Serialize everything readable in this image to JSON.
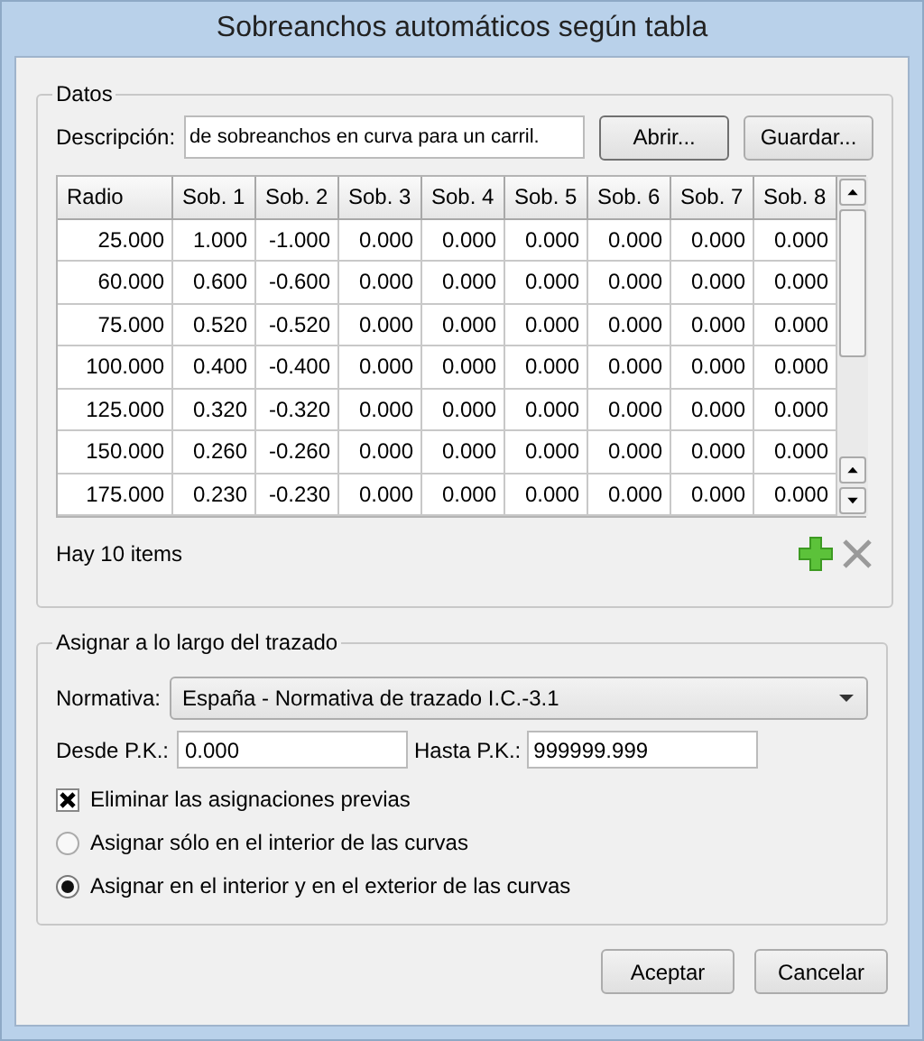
{
  "window": {
    "title": "Sobreanchos automáticos según tabla"
  },
  "datos": {
    "legend": "Datos",
    "description_label": "Descripción:",
    "description_value": "de sobreanchos en curva para un carril.",
    "buttons": [
      "Abrir...",
      "Guardar..."
    ],
    "table": {
      "columns": [
        "Radio",
        "Sob. 1",
        "Sob. 2",
        "Sob. 3",
        "Sob. 4",
        "Sob. 5",
        "Sob. 6",
        "Sob. 7",
        "Sob. 8"
      ],
      "rows": [
        [
          "25.000",
          "1.000",
          "-1.000",
          "0.000",
          "0.000",
          "0.000",
          "0.000",
          "0.000",
          "0.000"
        ],
        [
          "60.000",
          "0.600",
          "-0.600",
          "0.000",
          "0.000",
          "0.000",
          "0.000",
          "0.000",
          "0.000"
        ],
        [
          "75.000",
          "0.520",
          "-0.520",
          "0.000",
          "0.000",
          "0.000",
          "0.000",
          "0.000",
          "0.000"
        ],
        [
          "100.000",
          "0.400",
          "-0.400",
          "0.000",
          "0.000",
          "0.000",
          "0.000",
          "0.000",
          "0.000"
        ],
        [
          "125.000",
          "0.320",
          "-0.320",
          "0.000",
          "0.000",
          "0.000",
          "0.000",
          "0.000",
          "0.000"
        ],
        [
          "150.000",
          "0.260",
          "-0.260",
          "0.000",
          "0.000",
          "0.000",
          "0.000",
          "0.000",
          "0.000"
        ],
        [
          "175.000",
          "0.230",
          "-0.230",
          "0.000",
          "0.000",
          "0.000",
          "0.000",
          "0.000",
          "0.000"
        ]
      ]
    },
    "count": "Hay 10 items"
  },
  "asignar": {
    "legend": "Asignar a lo largo del trazado",
    "normativa_label": "Normativa:",
    "normativa_value": "España - Normativa de trazado I.C.-3.1",
    "desde_label": "Desde P.K.:",
    "desde_value": "0.000",
    "hasta_label": "Hasta P.K.:",
    "hasta_value": "999999.999",
    "checkbox": {
      "label": "Eliminar las asignaciones previas",
      "checked": true
    },
    "radios": [
      {
        "label": "Asignar sólo en el interior de las curvas",
        "selected": false
      },
      {
        "label": "Asignar en el interior y en el exterior de las curvas",
        "selected": true
      }
    ]
  },
  "buttons": [
    "Aceptar",
    "Cancelar"
  ]
}
